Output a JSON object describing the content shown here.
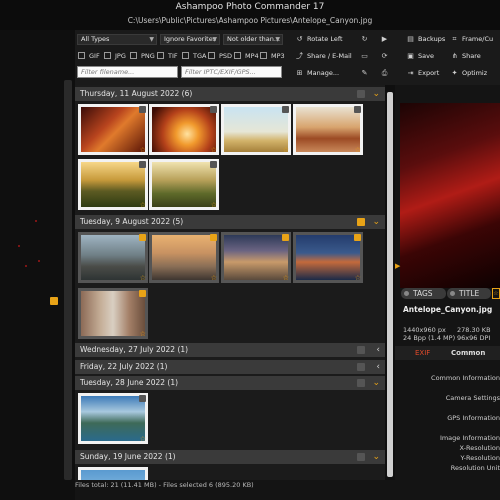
{
  "app": {
    "title": "Ashampoo Photo Commander 17",
    "path": "C:\\Users\\Public\\Pictures\\Ashampoo Pictures\\Antelope_Canyon.jpg"
  },
  "filters": {
    "types_value": "All Types",
    "favorites_value": "Ignore Favorites",
    "age_value": "Not older than...",
    "file_types": [
      "GIF",
      "JPG",
      "PNG",
      "TIF",
      "TGA",
      "PSD",
      "MP4",
      "MP3"
    ],
    "filename_placeholder": "Filter filename...",
    "iptc_placeholder": "Filter IPTC/EXIF/GPS..."
  },
  "toolbar": {
    "rotate_left": "Rotate Left",
    "share_email": "Share / E-Mail",
    "manage": "Manage...",
    "backups": "Backups",
    "save": "Save",
    "export": "Export",
    "frame_cut": "Frame/Cu",
    "share": "Share",
    "optimize": "Optimiz"
  },
  "groups": [
    {
      "label": "Thursday, 11 August 2022 (6)",
      "checked": false,
      "expanded": true
    },
    {
      "label": "Tuesday, 9 August 2022 (5)",
      "checked": true,
      "expanded": true
    },
    {
      "label": "Wednesday, 27 July 2022 (1)",
      "checked": false,
      "expanded": false
    },
    {
      "label": "Friday, 22 July 2022 (1)",
      "checked": false,
      "expanded": false
    },
    {
      "label": "Tuesday, 28 June 2022 (1)",
      "checked": false,
      "expanded": true
    },
    {
      "label": "Sunday, 19 June 2022 (1)",
      "checked": false,
      "expanded": true
    }
  ],
  "status": {
    "text": "Files total: 21 (11.41 MB) - Files selected 6 (895.20 KB)"
  },
  "right_panel": {
    "tags_label": "TAGS",
    "title_label": "TITLE",
    "filename": "Antelope_Canyon.jpg",
    "dimensions": "1440x960 px",
    "filesize": "278.30 KB",
    "bpp": "24 Bpp (1.4 MP)",
    "dpi": "96x96 DPI",
    "tab_exif": "EXIF",
    "tab_common": "Common",
    "info_rows": [
      "Common Information",
      "Camera Settings",
      "GPS Information",
      "Image Information",
      "X-Resolution",
      "Y-Resolution",
      "Resolution Unit"
    ]
  },
  "colors": {
    "accent": "#e8a317",
    "exif_tab": "#e04a2a"
  }
}
